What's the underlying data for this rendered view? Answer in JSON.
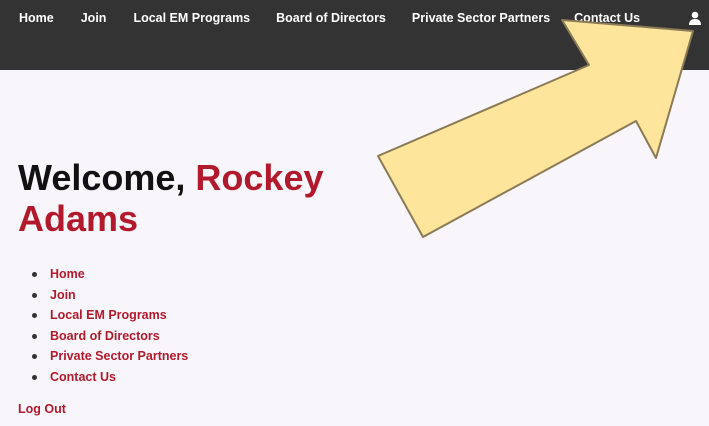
{
  "topnav": {
    "items": [
      {
        "label": "Home"
      },
      {
        "label": "Join"
      },
      {
        "label": "Local EM Programs"
      },
      {
        "label": "Board of Directors"
      },
      {
        "label": "Private Sector Partners"
      },
      {
        "label": "Contact Us"
      }
    ],
    "user_icon": "user-icon"
  },
  "welcome": {
    "greeting": "Welcome, ",
    "name": "Rockey Adams"
  },
  "sidelist": {
    "items": [
      {
        "label": "Home"
      },
      {
        "label": "Join"
      },
      {
        "label": "Local EM Programs"
      },
      {
        "label": "Board of Directors"
      },
      {
        "label": "Private Sector Partners"
      },
      {
        "label": "Contact Us"
      }
    ]
  },
  "logout_label": "Log Out",
  "colors": {
    "nav_bg": "#333333",
    "accent": "#b3192c",
    "arrow_fill": "#fde59c",
    "arrow_stroke": "#8a7a55"
  }
}
